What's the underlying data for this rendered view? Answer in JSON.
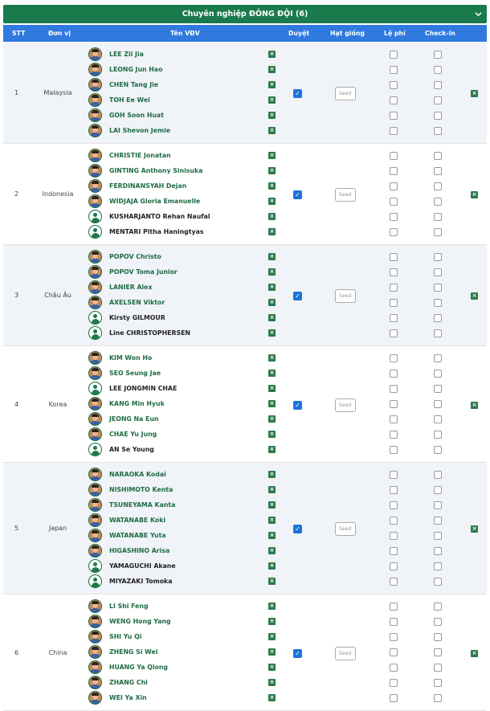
{
  "panel": {
    "title": "Chuyên nghiệp ĐÔNG ĐỘI (6)"
  },
  "columns": {
    "stt": "STT",
    "unit": "Đơn vị",
    "athlete": "Tên VĐV",
    "approved": "Duyệt",
    "seed": "Hạt giống",
    "fee": "Lệ phí",
    "checkin": "Check-in"
  },
  "seed_placeholder": "Seed",
  "icons": {
    "remove": "close-x-icon",
    "collapse": "chevron-down-icon"
  },
  "colors": {
    "header_green": "#1a7a4c",
    "table_header_blue": "#2f79df",
    "name_green": "#1e6b45"
  },
  "groups": [
    {
      "stt": "1",
      "unit": "Malaysia",
      "approved": true,
      "players": [
        {
          "name": "LEE Zii Jia",
          "photo": true
        },
        {
          "name": "LEONG Jun Hao",
          "photo": true
        },
        {
          "name": "CHEN Tang Jie",
          "photo": true
        },
        {
          "name": "TOH Ee Wei",
          "photo": true
        },
        {
          "name": "GOH Soon Huat",
          "photo": true
        },
        {
          "name": "LAI Shevon Jemie",
          "photo": true
        }
      ]
    },
    {
      "stt": "2",
      "unit": "Indonesia",
      "approved": true,
      "players": [
        {
          "name": "CHRISTIE Jonatan",
          "photo": true
        },
        {
          "name": "GINTING Anthony Sinisuka",
          "photo": true
        },
        {
          "name": "FERDINANSYAH Dejan",
          "photo": true
        },
        {
          "name": "WIDJAJA Gloria Emanuelle",
          "photo": true
        },
        {
          "name": "KUSHARJANTO Rehan Naufal",
          "photo": false
        },
        {
          "name": "MENTARI Pitha Haningtyas",
          "photo": false
        }
      ]
    },
    {
      "stt": "3",
      "unit": "Châu Âu",
      "approved": true,
      "players": [
        {
          "name": "POPOV Christo",
          "photo": true
        },
        {
          "name": "POPOV Toma Junior",
          "photo": true
        },
        {
          "name": "LANIER Alex",
          "photo": true
        },
        {
          "name": "AXELSEN Viktor",
          "photo": true
        },
        {
          "name": "Kirsty GILMOUR",
          "photo": false
        },
        {
          "name": "Line CHRISTOPHERSEN",
          "photo": false
        }
      ]
    },
    {
      "stt": "4",
      "unit": "Korea",
      "approved": true,
      "players": [
        {
          "name": "KIM Won Ho",
          "photo": true
        },
        {
          "name": "SEO Seung Jae",
          "photo": true
        },
        {
          "name": "LEE JONGMIN CHAE",
          "photo": false
        },
        {
          "name": "KANG Min Hyuk",
          "photo": true
        },
        {
          "name": "JEONG Na Eun",
          "photo": true
        },
        {
          "name": "CHAE Yu Jung",
          "photo": true
        },
        {
          "name": "AN Se Young",
          "photo": false
        }
      ]
    },
    {
      "stt": "5",
      "unit": "Japan",
      "approved": true,
      "players": [
        {
          "name": "NARAOKA Kodai",
          "photo": true
        },
        {
          "name": "NISHIMOTO Kenta",
          "photo": true
        },
        {
          "name": "TSUNEYAMA Kanta",
          "photo": true
        },
        {
          "name": "WATANABE Koki",
          "photo": true
        },
        {
          "name": "WATANABE Yuta",
          "photo": true
        },
        {
          "name": "HIGASHINO Arisa",
          "photo": true
        },
        {
          "name": "YAMAGUCHI Akane",
          "photo": false
        },
        {
          "name": "MIYAZAKI Tomoka",
          "photo": false
        }
      ]
    },
    {
      "stt": "6",
      "unit": "China",
      "approved": true,
      "players": [
        {
          "name": "LI Shi Feng",
          "photo": true
        },
        {
          "name": "WENG Hong Yang",
          "photo": true
        },
        {
          "name": "SHI Yu Qi",
          "photo": true
        },
        {
          "name": "ZHENG Si Wei",
          "photo": true
        },
        {
          "name": "HUANG Ya Qiong",
          "photo": true
        },
        {
          "name": "ZHANG Chi",
          "photo": true
        },
        {
          "name": "WEI Ya Xin",
          "photo": true
        }
      ]
    }
  ]
}
